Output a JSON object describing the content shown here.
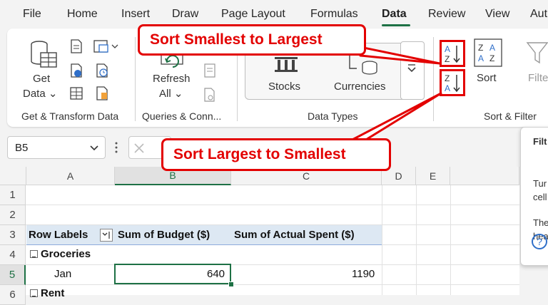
{
  "menu": {
    "tabs": [
      "File",
      "Home",
      "Insert",
      "Draw",
      "Page Layout",
      "Formulas",
      "Data",
      "Review",
      "View",
      "Aut"
    ],
    "active": "Data"
  },
  "ribbon": {
    "get_data": {
      "line1": "Get",
      "line2": "Data ⌄"
    },
    "refresh_all": {
      "line1": "Refresh",
      "line2": "All ⌄"
    },
    "stocks": "Stocks",
    "currencies": "Currencies",
    "sort": "Sort",
    "filter": "Filte",
    "groups": {
      "get_transform": "Get & Transform Data",
      "queries": "Queries & Conn...",
      "data_types": "Data Types",
      "sort_filter": "Sort & Filter"
    }
  },
  "callouts": {
    "asc": "Sort Smallest to Largest",
    "desc": "Sort Largest to Smallest"
  },
  "namebox": {
    "value": "B5"
  },
  "tooltip": {
    "title": "Filt",
    "l1": "Tur",
    "l2": "cell",
    "l3": "The",
    "l4": "hea",
    "help": "?"
  },
  "columns": [
    "A",
    "B",
    "C",
    "D",
    "E"
  ],
  "rows": [
    "1",
    "2",
    "3",
    "4",
    "5",
    "6"
  ],
  "pivot": {
    "row_labels": "Row Labels",
    "budget": "Sum of Budget ($)",
    "actual": "Sum of Actual Spent ($)",
    "group1": "Groceries",
    "month": "Jan",
    "budget_value": "640",
    "actual_value": "1190",
    "group2": "Rent"
  },
  "colors": {
    "excel_green": "#1e7145",
    "callout_red": "#e30000",
    "pivot_header": "#dde8f3"
  }
}
